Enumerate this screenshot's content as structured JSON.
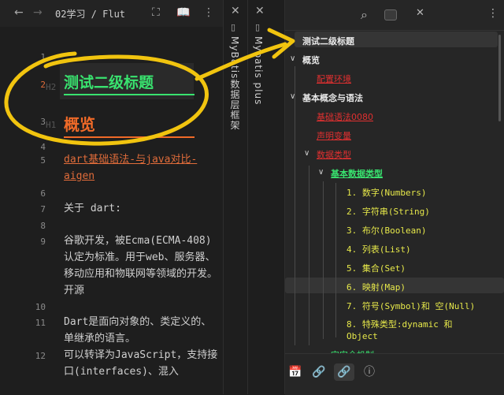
{
  "editor": {
    "breadcrumb": "02学习 / Flut",
    "icons": [
      "back-arrow-icon",
      "forward-arrow-icon",
      "expand-icon",
      "book-icon",
      "more-icon"
    ],
    "lines": [
      {
        "n": "1"
      },
      {
        "n": "2",
        "tag": "H2"
      },
      {
        "n": "3",
        "tag": "H1"
      },
      {
        "n": "4"
      },
      {
        "n": "5"
      },
      {
        "n": "6"
      },
      {
        "n": "7"
      },
      {
        "n": "8"
      },
      {
        "n": "9"
      },
      {
        "n": "10"
      },
      {
        "n": "11"
      },
      {
        "n": "12"
      }
    ],
    "h2_text": "测试二级标题",
    "h1_text": "概览",
    "link_text": "dart基础语法-与java对比-aigen",
    "about": "关于 dart:",
    "para1": "谷歌开发，被Ecma(ECMA-408)认定为标准。用于web、服务器、移动应用和物联网等领域的开发。开源",
    "para2": "Dart是面向对象的、类定义的、单继承的语言。",
    "para3": "可以转译为JavaScript，支持接口(interfaces)、混入"
  },
  "tab_mybatis_db": {
    "title": "MyBatis数据层框架"
  },
  "tab_mybatis_plus": {
    "title": "Mybatis plus"
  },
  "outline": {
    "items": [
      {
        "label": "测试二级标题"
      },
      {
        "label": "概览"
      },
      {
        "label": "配置环境"
      },
      {
        "label": "基本概念与语法"
      },
      {
        "label": "基础语法0080"
      },
      {
        "label": "声明变量"
      },
      {
        "label": "数据类型"
      },
      {
        "label": "基本数据类型"
      },
      {
        "label": "1. 数字(Numbers)"
      },
      {
        "label": "2. 字符串(String)"
      },
      {
        "label": "3. 布尔(Boolean)"
      },
      {
        "label": "4. 列表(List)"
      },
      {
        "label": "5. 集合(Set)"
      },
      {
        "label": "6. 映射(Map)"
      },
      {
        "label": "7. 符号(Symbol)和 空(Null)"
      },
      {
        "label": "8. 特殊类型:dynamic 和 Object"
      },
      {
        "label": "空安全机制"
      }
    ]
  },
  "colors": {
    "accent_green": "#39e36f",
    "heading_orange": "#f06a28",
    "annot_yellow": "#f1c40f",
    "link_red": "#e03030"
  }
}
